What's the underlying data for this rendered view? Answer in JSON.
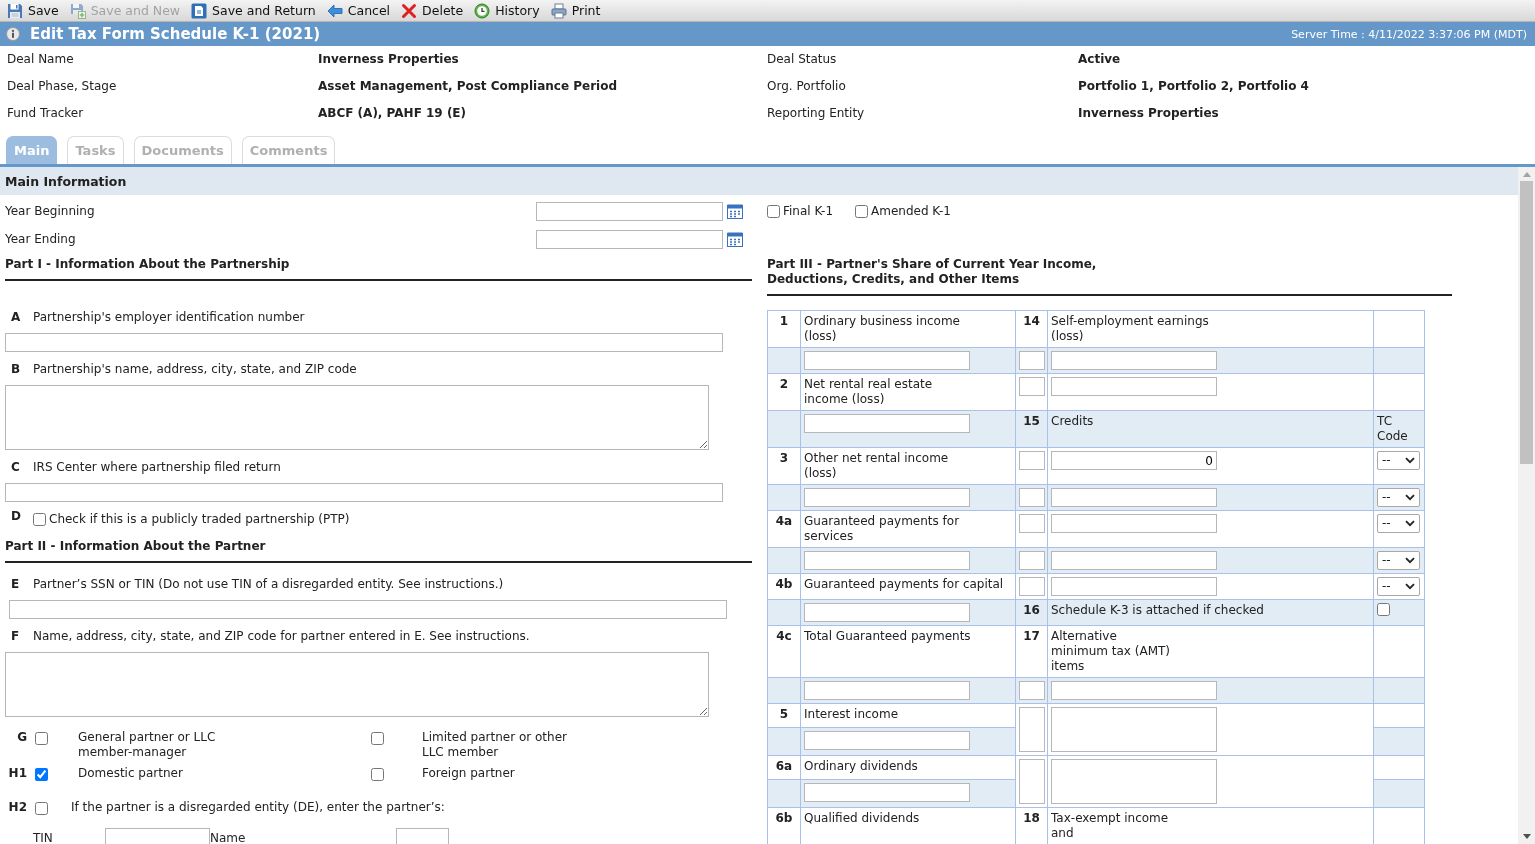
{
  "toolbar": [
    {
      "kind": "save",
      "label": "Save",
      "disabled": false
    },
    {
      "kind": "save_new",
      "label": "Save and New",
      "disabled": true
    },
    {
      "kind": "save_return",
      "label": "Save and Return",
      "disabled": false
    },
    {
      "kind": "cancel",
      "label": "Cancel",
      "disabled": false
    },
    {
      "kind": "delete",
      "label": "Delete",
      "disabled": false
    },
    {
      "kind": "history",
      "label": "History",
      "disabled": false
    },
    {
      "kind": "print",
      "label": "Print",
      "disabled": false
    }
  ],
  "title_bar": {
    "title": "Edit Tax Form Schedule K-1 (2021)",
    "server_time": "Server Time : 4/11/2022 3:37:06 PM (MDT)"
  },
  "deal_info": [
    {
      "label": "Deal Name",
      "value": "Inverness Properties"
    },
    {
      "label": "Deal Status",
      "value": "Active"
    },
    {
      "label": "Deal Phase, Stage",
      "value": "Asset Management, Post Compliance Period"
    },
    {
      "label": "Org. Portfolio",
      "value": "Portfolio 1, Portfolio 2, Portfolio 4"
    },
    {
      "label": "Fund Tracker",
      "value": "ABCF (A), PAHF 19 (E)"
    },
    {
      "label": "Reporting Entity",
      "value": "Inverness Properties"
    }
  ],
  "tabs": [
    {
      "label": "Main",
      "selected": true
    },
    {
      "label": "Tasks",
      "selected": false
    },
    {
      "label": "Documents",
      "selected": false
    },
    {
      "label": "Comments",
      "selected": false
    }
  ],
  "main_information": {
    "title": "Main Information",
    "dates": [
      {
        "label": "Year Beginning"
      },
      {
        "label": "Year Ending"
      }
    ],
    "k1_type": [
      {
        "label": "Final K-1",
        "checked": false
      },
      {
        "label": "Amended K-1",
        "checked": false
      }
    ]
  },
  "part_1": {
    "title": "Part I - Information About the Partnership",
    "items": [
      {
        "letter": "A",
        "label": "Partnership's employer identification number",
        "kind": "input"
      },
      {
        "letter": "B",
        "label": "Partnership's name, address, city, state, and ZIP code",
        "kind": "textarea"
      },
      {
        "letter": "C",
        "label": "IRS Center where partnership filed return",
        "kind": "input"
      },
      {
        "letter": "D",
        "label": "Check if this is a publicly traded partnership (PTP)",
        "kind": "checkbox",
        "checked": false
      }
    ]
  },
  "part_2": {
    "title": "Part II - Information About the Partner",
    "items": [
      {
        "letter": "E",
        "label": "Partner’s SSN or TIN (Do not use TIN of a disregarded entity. See instructions.)",
        "kind": "input"
      },
      {
        "letter": "F",
        "label": "Name, address, city, state, and ZIP code for partner entered in E. See instructions.",
        "kind": "textarea"
      }
    ],
    "partner_types": [
      {
        "letter": "G",
        "options": [
          {
            "label": "General partner or LLC\nmember-manager",
            "checked": false
          },
          {
            "label": "Limited partner or other\nLLC member",
            "checked": false
          }
        ]
      },
      {
        "letter": "H1",
        "options": [
          {
            "label": "Domestic partner",
            "checked": true
          },
          {
            "label": "Foreign partner",
            "checked": false
          }
        ]
      }
    ],
    "disregarded_entity": {
      "letter": "H2",
      "checked": false,
      "label": "If the partner is a disregarded entity (DE), enter the partner’s:",
      "fields": [
        {
          "label": "TIN"
        },
        {
          "label": "Name"
        }
      ]
    }
  },
  "part_3": {
    "title": "Part III - Partner's Share of Current Year Income,\nDeductions, Credits, and Other Items",
    "rows": [
      {
        "kind": "caption",
        "cells": [
          {
            "kind": "number",
            "text": "1"
          },
          {
            "kind": "text",
            "text": "Ordinary business income\n(loss)"
          },
          {
            "kind": "number",
            "text": "14"
          },
          {
            "kind": "text",
            "text": "Self-employment earnings\n(loss)"
          },
          {
            "kind": "blank"
          }
        ]
      },
      {
        "kind": "entry",
        "cells": [
          {
            "kind": "blank"
          },
          {
            "kind": "field"
          },
          {
            "kind": "short_field"
          },
          {
            "kind": "field"
          },
          {
            "kind": "blank"
          }
        ]
      },
      {
        "kind": "caption",
        "cells": [
          {
            "kind": "number",
            "text": "2"
          },
          {
            "kind": "text",
            "text": "Net rental real estate\nincome (loss)"
          },
          {
            "kind": "short_field"
          },
          {
            "kind": "field"
          },
          {
            "kind": "blank"
          }
        ]
      },
      {
        "kind": "entry",
        "cells": [
          {
            "kind": "blank"
          },
          {
            "kind": "field"
          },
          {
            "kind": "number",
            "text": "15"
          },
          {
            "kind": "text",
            "text": "Credits"
          },
          {
            "kind": "text",
            "text": "TC\nCode"
          }
        ]
      },
      {
        "kind": "caption",
        "cells": [
          {
            "kind": "number",
            "text": "3"
          },
          {
            "kind": "text",
            "text": "Other net rental income\n(loss)"
          },
          {
            "kind": "short_field"
          },
          {
            "kind": "field",
            "value": "0"
          },
          {
            "kind": "select",
            "value": "--"
          }
        ]
      },
      {
        "kind": "entry",
        "cells": [
          {
            "kind": "blank"
          },
          {
            "kind": "field"
          },
          {
            "kind": "short_field"
          },
          {
            "kind": "field"
          },
          {
            "kind": "select",
            "value": "--"
          }
        ]
      },
      {
        "kind": "caption",
        "cells": [
          {
            "kind": "number",
            "text": "4a"
          },
          {
            "kind": "text",
            "text": "Guaranteed payments for\nservices"
          },
          {
            "kind": "short_field"
          },
          {
            "kind": "field"
          },
          {
            "kind": "select",
            "value": "--"
          }
        ]
      },
      {
        "kind": "entry",
        "cells": [
          {
            "kind": "blank"
          },
          {
            "kind": "field"
          },
          {
            "kind": "short_field"
          },
          {
            "kind": "field"
          },
          {
            "kind": "select",
            "value": "--"
          }
        ]
      },
      {
        "kind": "caption",
        "cells": [
          {
            "kind": "number",
            "text": "4b"
          },
          {
            "kind": "text",
            "text": "Guaranteed payments for capital"
          },
          {
            "kind": "short_field"
          },
          {
            "kind": "field"
          },
          {
            "kind": "select",
            "value": "--"
          }
        ]
      },
      {
        "kind": "entry",
        "cells": [
          {
            "kind": "blank"
          },
          {
            "kind": "field"
          },
          {
            "kind": "number",
            "text": "16"
          },
          {
            "kind": "text",
            "text": "Schedule K-3 is attached if checked"
          },
          {
            "kind": "checkbox",
            "checked": false
          }
        ]
      },
      {
        "kind": "caption",
        "cells": [
          {
            "kind": "number",
            "text": "4c"
          },
          {
            "kind": "text",
            "text": "Total Guaranteed payments"
          },
          {
            "kind": "number",
            "text": "17"
          },
          {
            "kind": "text",
            "text": "Alternative\nminimum tax (AMT)\nitems"
          },
          {
            "kind": "blank"
          }
        ]
      },
      {
        "kind": "entry",
        "cells": [
          {
            "kind": "blank"
          },
          {
            "kind": "field"
          },
          {
            "kind": "short_field"
          },
          {
            "kind": "field"
          },
          {
            "kind": "blank"
          }
        ]
      },
      {
        "kind": "caption",
        "cells": [
          {
            "kind": "number",
            "text": "5"
          },
          {
            "kind": "text",
            "text": "Interest income"
          },
          {
            "kind": "tall_short_field"
          },
          {
            "kind": "tall_field"
          },
          {
            "kind": "blank"
          }
        ]
      },
      {
        "kind": "entry",
        "cells": [
          {
            "kind": "blank"
          },
          {
            "kind": "field"
          },
          {
            "kind": "blank"
          }
        ]
      },
      {
        "kind": "caption",
        "cells": [
          {
            "kind": "number",
            "text": "6a"
          },
          {
            "kind": "text",
            "text": "Ordinary dividends"
          },
          {
            "kind": "tall_short_field"
          },
          {
            "kind": "tall_field"
          },
          {
            "kind": "blank"
          }
        ]
      },
      {
        "kind": "entry",
        "cells": [
          {
            "kind": "blank"
          },
          {
            "kind": "field"
          },
          {
            "kind": "blank"
          }
        ]
      },
      {
        "kind": "caption",
        "cells": [
          {
            "kind": "number",
            "text": "6b"
          },
          {
            "kind": "text",
            "text": "Qualified dividends"
          },
          {
            "kind": "number",
            "text": "18"
          },
          {
            "kind": "text",
            "text": "Tax-exempt income\nand"
          },
          {
            "kind": "blank"
          }
        ]
      }
    ]
  }
}
